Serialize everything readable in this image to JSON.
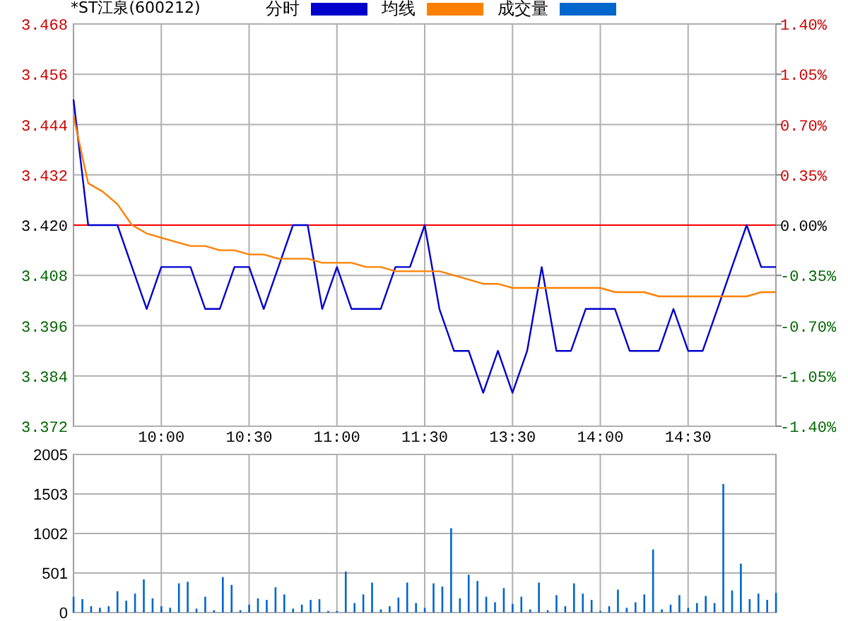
{
  "header": {
    "title": "*ST江泉(600212)"
  },
  "price_chart": {
    "chart_data": {
      "type": "line",
      "ylim": [
        3.372,
        3.468
      ],
      "categories": [
        null,
        null,
        null,
        null,
        null,
        null,
        "10:00",
        null,
        null,
        null,
        null,
        null,
        "10:30",
        null,
        null,
        null,
        null,
        null,
        "11:00",
        null,
        null,
        null,
        null,
        null,
        "11:30",
        null,
        null,
        null,
        null,
        null,
        "13:30",
        null,
        null,
        null,
        null,
        null,
        "14:00",
        null,
        null,
        null,
        null,
        null,
        "14:30",
        null,
        null,
        null,
        null,
        null,
        null
      ],
      "yticks": [
        {
          "value": 3.468,
          "label": "3.468"
        },
        {
          "value": 3.456,
          "label": "3.456"
        },
        {
          "value": 3.444,
          "label": "3.444"
        },
        {
          "value": 3.432,
          "label": "3.432"
        },
        {
          "value": 3.42,
          "label": "3.420"
        },
        {
          "value": 3.408,
          "label": "3.408"
        },
        {
          "value": 3.396,
          "label": "3.396"
        },
        {
          "value": 3.384,
          "label": "3.384"
        },
        {
          "value": 3.372,
          "label": "3.372"
        }
      ],
      "series": [
        {
          "name": "分时",
          "color": "#0000cc",
          "values": [
            3.45,
            3.42,
            3.42,
            3.42,
            3.41,
            3.4,
            3.41,
            3.41,
            3.41,
            3.4,
            3.4,
            3.41,
            3.41,
            3.4,
            3.41,
            3.42,
            3.42,
            3.4,
            3.41,
            3.4,
            3.4,
            3.4,
            3.41,
            3.41,
            3.42,
            3.4,
            3.39,
            3.39,
            3.38,
            3.39,
            3.38,
            3.39,
            3.41,
            3.39,
            3.39,
            3.4,
            3.4,
            3.4,
            3.39,
            3.39,
            3.39,
            3.4,
            3.39,
            3.39,
            3.4,
            3.41,
            3.42,
            3.41,
            3.41
          ]
        },
        {
          "name": "均线",
          "color": "#ff8000",
          "values": [
            3.446,
            3.43,
            3.428,
            3.425,
            3.42,
            3.418,
            3.417,
            3.416,
            3.415,
            3.415,
            3.414,
            3.414,
            3.413,
            3.413,
            3.412,
            3.412,
            3.412,
            3.411,
            3.411,
            3.411,
            3.41,
            3.41,
            3.409,
            3.409,
            3.409,
            3.409,
            3.408,
            3.407,
            3.406,
            3.406,
            3.405,
            3.405,
            3.405,
            3.405,
            3.405,
            3.405,
            3.405,
            3.404,
            3.404,
            3.404,
            3.403,
            3.403,
            3.403,
            3.403,
            3.403,
            3.403,
            3.403,
            3.404,
            3.404
          ]
        }
      ],
      "ref_lines": [
        {
          "axis": "y",
          "value": 3.42
        }
      ],
      "grid": true
    },
    "right_axis": {
      "ticks": [
        "1.40%",
        "1.05%",
        "0.70%",
        "0.35%",
        "0.00%",
        "-0.35%",
        "-0.70%",
        "-1.05%",
        "-1.40%"
      ]
    }
  },
  "volume_chart": {
    "chart_data": {
      "type": "bar",
      "grid": true,
      "ylim": [
        0,
        2005
      ],
      "yticks": [
        0,
        501,
        1002,
        1503,
        2005
      ],
      "categories": [
        null,
        null,
        null,
        null,
        null,
        null,
        null,
        null,
        null,
        null,
        null,
        null,
        null,
        null,
        null,
        null,
        null,
        null,
        null,
        null,
        null,
        null,
        null,
        null,
        null,
        null,
        null,
        null,
        null,
        null,
        null,
        null,
        null,
        null,
        null,
        null,
        null,
        null,
        null,
        null,
        null,
        null,
        null,
        null,
        null,
        null,
        null,
        null,
        null,
        null,
        null,
        null,
        null,
        null,
        null,
        null,
        null,
        null,
        null,
        null,
        null,
        null,
        null,
        null,
        null,
        null,
        null,
        null,
        null,
        null,
        null,
        null,
        null,
        null,
        null,
        null,
        null,
        null,
        null,
        null,
        null
      ],
      "series": [
        {
          "name": "成交量",
          "color": "#0066cc",
          "values": [
            200,
            170,
            80,
            60,
            80,
            270,
            150,
            240,
            420,
            180,
            80,
            60,
            370,
            390,
            50,
            200,
            30,
            450,
            350,
            30,
            100,
            180,
            160,
            320,
            230,
            50,
            100,
            160,
            170,
            20,
            20,
            520,
            120,
            230,
            380,
            40,
            80,
            190,
            380,
            120,
            60,
            370,
            330,
            1070,
            180,
            480,
            400,
            200,
            130,
            310,
            110,
            200,
            40,
            380,
            30,
            220,
            80,
            370,
            240,
            160,
            20,
            80,
            290,
            60,
            130,
            230,
            800,
            40,
            100,
            220,
            60,
            120,
            210,
            120,
            1630,
            280,
            620,
            170,
            240,
            160,
            250
          ]
        }
      ]
    }
  }
}
